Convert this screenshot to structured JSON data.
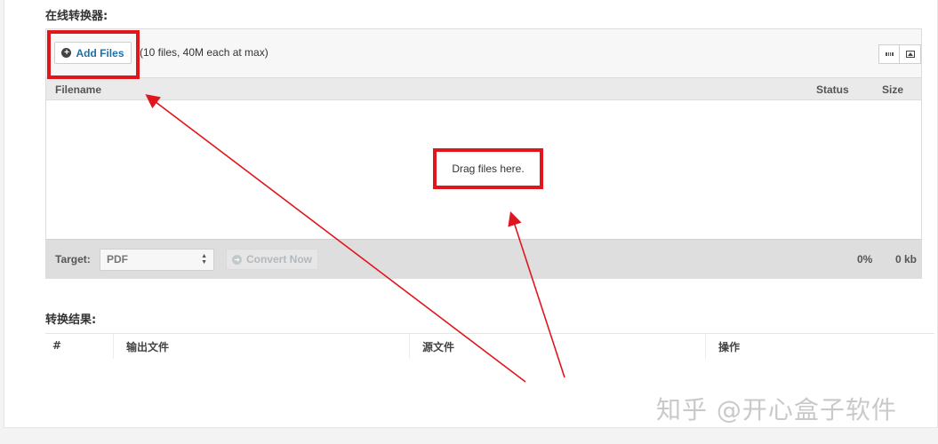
{
  "sections": {
    "converter_title": "在线转换器:",
    "results_title": "转换结果:"
  },
  "uploader": {
    "add_files_label": "Add Files",
    "add_files_icon": "plus-circle-icon",
    "limit_text": "(10 files, 40M each at max)",
    "view_list_icon": "list-view-icon",
    "view_thumb_icon": "thumbnail-view-icon",
    "columns": {
      "filename": "Filename",
      "status": "Status",
      "size": "Size"
    },
    "drop_text": "Drag files here.",
    "footer": {
      "target_label": "Target:",
      "target_value": "PDF",
      "convert_label": "Convert Now",
      "convert_icon": "arrow-right-circle-icon",
      "percent": "0%",
      "total_size": "0 kb"
    }
  },
  "results_table": {
    "columns": [
      "#",
      "输出文件",
      "源文件",
      "操作"
    ]
  },
  "annotations": {
    "color": "#e0161c"
  },
  "watermark": "知乎 @开心盒子软件"
}
